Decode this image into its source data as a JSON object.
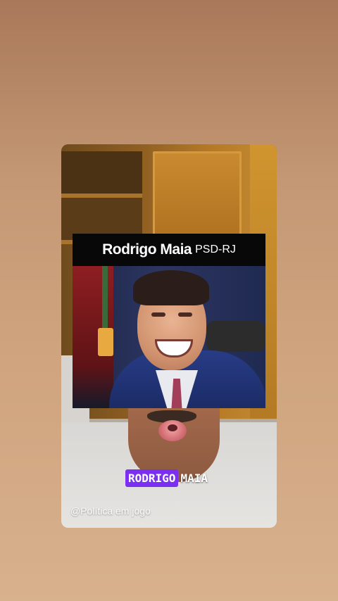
{
  "inset": {
    "name": "Rodrigo Maia",
    "party": "PSD-RJ"
  },
  "caption": {
    "highlight": "RODRIGO",
    "rest": "MAIA"
  },
  "watermark": {
    "handle": "@Política em jogo"
  }
}
